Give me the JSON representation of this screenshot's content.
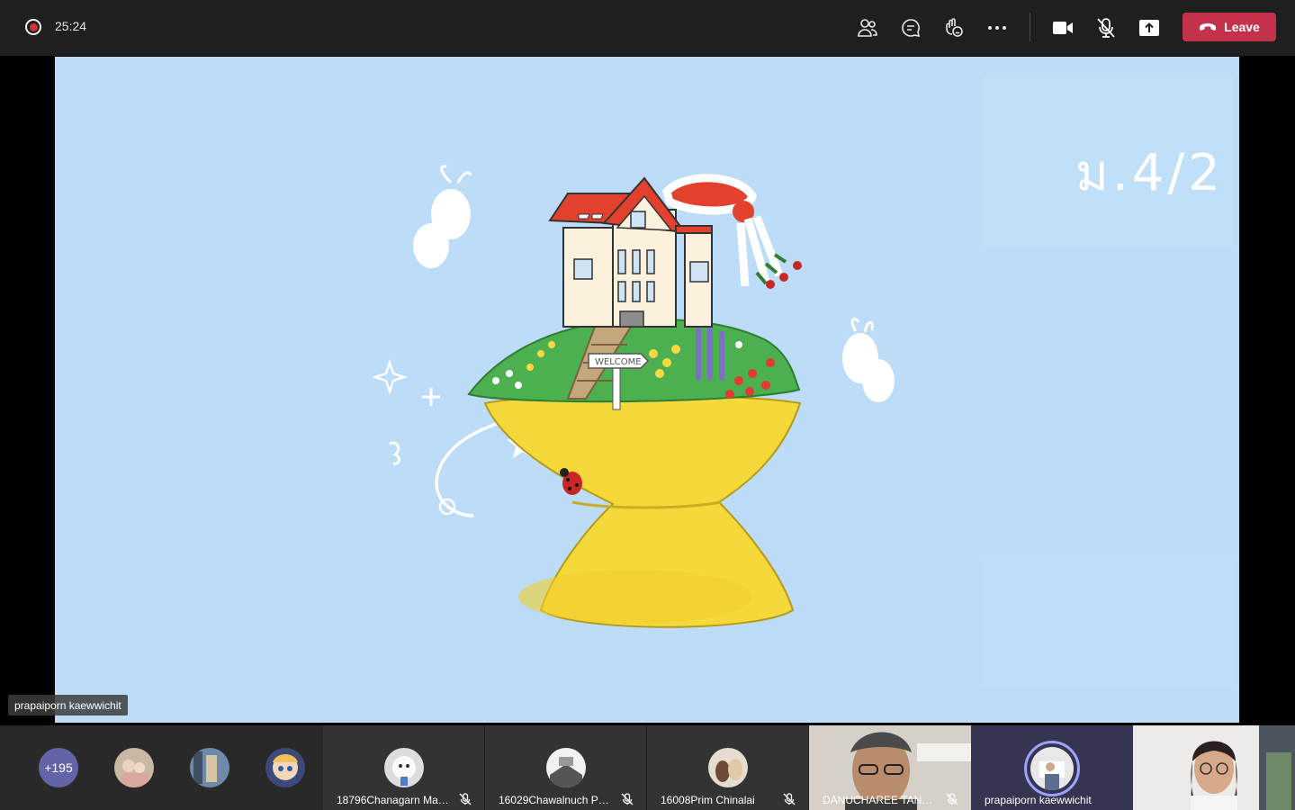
{
  "topbar": {
    "timer": "25:24",
    "leave_label": "Leave",
    "icons": [
      "people-icon",
      "chat-icon",
      "reactions-icon",
      "more-icon",
      "camera-icon",
      "mic-off-icon",
      "share-icon",
      "phone-icon"
    ]
  },
  "shared_screen": {
    "class_label": "ม.4/2",
    "presenter": "prapaiporn kaewwichit",
    "sign_text": "WELCOME"
  },
  "gallery": {
    "overflow_count": "+195",
    "tiles": [
      {
        "name": "18796Chanagarn Mar...",
        "muted": true
      },
      {
        "name": "16029Chawalnuch Plu...",
        "muted": true
      },
      {
        "name": "16008Prim Chinalai",
        "muted": true
      },
      {
        "name": "DANUCHAREE TANTH...",
        "muted": true
      },
      {
        "name": "prapaiporn kaewwichit",
        "muted": false
      },
      {
        "name": "",
        "muted": false
      }
    ]
  },
  "colors": {
    "topbar_bg": "#1f1f1f",
    "leave_red": "#c4314b",
    "slide_bg": "#bcdcf8",
    "teams_purple": "#6264a7"
  }
}
